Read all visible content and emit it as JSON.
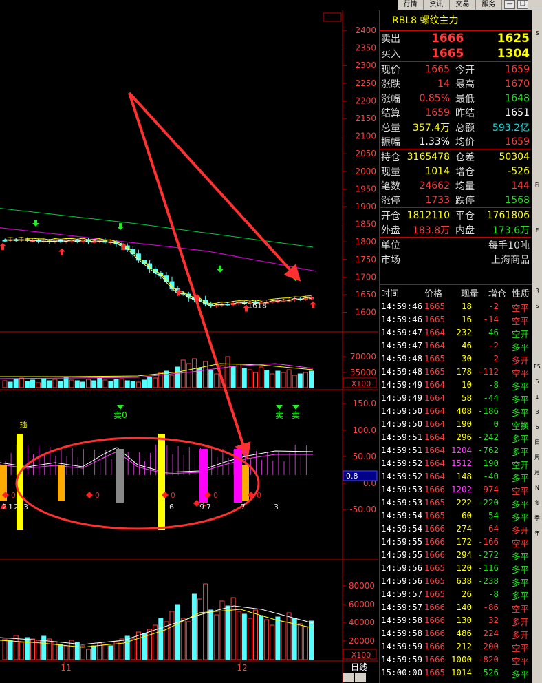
{
  "topbar": {
    "tabs": [
      "行情",
      "资讯",
      "交易",
      "服务"
    ],
    "btn_min": "—",
    "btn_restore": "❐"
  },
  "quote": {
    "title": "RBL8 螺纹主力",
    "sell": {
      "label": "卖出",
      "price": "1666",
      "vol": "1625"
    },
    "buy": {
      "label": "买入",
      "price": "1665",
      "vol": "1304"
    },
    "rows1": [
      {
        "l1": "现价",
        "v1": "1665",
        "c1": "red",
        "l2": "今开",
        "v2": "1659",
        "c2": "red"
      },
      {
        "l1": "涨跌",
        "v1": "14",
        "c1": "red",
        "l2": "最高",
        "v2": "1670",
        "c2": "red"
      },
      {
        "l1": "涨幅",
        "v1": "0.85%",
        "c1": "red",
        "l2": "最低",
        "v2": "1648",
        "c2": "grn"
      },
      {
        "l1": "结算",
        "v1": "1659",
        "c1": "red",
        "l2": "昨结",
        "v2": "1651",
        "c2": "wht"
      },
      {
        "l1": "总量",
        "v1": "357.4万",
        "c1": "yel",
        "l2": "总额",
        "v2": "593.2亿",
        "c2": "cyn"
      },
      {
        "l1": "振幅",
        "v1": "1.33%",
        "c1": "wht",
        "l2": "均价",
        "v2": "1659",
        "c2": "red"
      }
    ],
    "rows2": [
      {
        "l1": "持仓",
        "v1": "3165478",
        "c1": "yel",
        "l2": "仓差",
        "v2": "50304",
        "c2": "yel"
      },
      {
        "l1": "现量",
        "v1": "1014",
        "c1": "yel",
        "l2": "增仓",
        "v2": "-526",
        "c2": "yel"
      },
      {
        "l1": "笔数",
        "v1": "24662",
        "c1": "red",
        "l2": "均量",
        "v2": "144",
        "c2": "red"
      },
      {
        "l1": "涨停",
        "v1": "1733",
        "c1": "red",
        "l2": "跌停",
        "v2": "1568",
        "c2": "grn"
      }
    ],
    "rows3": [
      {
        "l1": "开仓",
        "v1": "1812110",
        "c1": "yel",
        "l2": "平仓",
        "v2": "1761806",
        "c2": "yel"
      },
      {
        "l1": "外盘",
        "v1": "183.8万",
        "c1": "red",
        "l2": "内盘",
        "v2": "173.6万",
        "c2": "grn"
      }
    ],
    "unit": {
      "l": "单位",
      "v": "每手10吨"
    },
    "market": {
      "l": "市场",
      "v": "上海商品"
    }
  },
  "ticks": {
    "headers": [
      "时间",
      "价格",
      "现量",
      "增仓",
      "性质"
    ],
    "rows": [
      [
        "14:59:46",
        "1665",
        "18",
        "-2",
        "空平",
        "red",
        "yel",
        "red",
        "red"
      ],
      [
        "14:59:46",
        "1665",
        "16",
        "-14",
        "空平",
        "red",
        "yel",
        "red",
        "red"
      ],
      [
        "14:59:47",
        "1664",
        "232",
        "46",
        "空开",
        "red",
        "yel",
        "grn",
        "grn"
      ],
      [
        "14:59:47",
        "1664",
        "46",
        "-2",
        "多平",
        "red",
        "yel",
        "red",
        "grn"
      ],
      [
        "14:59:48",
        "1665",
        "30",
        "2",
        "多开",
        "red",
        "yel",
        "red",
        "red"
      ],
      [
        "14:59:48",
        "1665",
        "178",
        "-112",
        "空平",
        "red",
        "yel",
        "red",
        "red"
      ],
      [
        "14:59:49",
        "1664",
        "10",
        "-8",
        "多平",
        "red",
        "yel",
        "grn",
        "grn"
      ],
      [
        "14:59:49",
        "1664",
        "58",
        "-44",
        "多平",
        "red",
        "yel",
        "grn",
        "grn"
      ],
      [
        "14:59:50",
        "1664",
        "408",
        "-186",
        "多平",
        "red",
        "yel",
        "grn",
        "grn"
      ],
      [
        "14:59:50",
        "1664",
        "190",
        "0",
        "空换",
        "red",
        "yel",
        "grn",
        "grn"
      ],
      [
        "14:59:51",
        "1664",
        "296",
        "-242",
        "多平",
        "red",
        "yel",
        "grn",
        "grn"
      ],
      [
        "14:59:51",
        "1664",
        "1204",
        "-762",
        "多平",
        "red",
        "mag",
        "grn",
        "grn"
      ],
      [
        "14:59:52",
        "1664",
        "1512",
        "190",
        "空开",
        "red",
        "mag",
        "grn",
        "grn"
      ],
      [
        "14:59:52",
        "1664",
        "148",
        "-40",
        "多平",
        "red",
        "yel",
        "grn",
        "grn"
      ],
      [
        "14:59:53",
        "1666",
        "1202",
        "-974",
        "空平",
        "red",
        "mag",
        "red",
        "red"
      ],
      [
        "14:59:53",
        "1665",
        "222",
        "-220",
        "多平",
        "red",
        "yel",
        "grn",
        "grn"
      ],
      [
        "14:59:54",
        "1665",
        "60",
        "-54",
        "多平",
        "red",
        "yel",
        "grn",
        "grn"
      ],
      [
        "14:59:54",
        "1666",
        "274",
        "64",
        "多开",
        "red",
        "yel",
        "red",
        "red"
      ],
      [
        "14:59:55",
        "1666",
        "172",
        "-166",
        "空平",
        "red",
        "yel",
        "red",
        "red"
      ],
      [
        "14:59:55",
        "1666",
        "294",
        "-272",
        "多平",
        "red",
        "yel",
        "grn",
        "grn"
      ],
      [
        "14:59:56",
        "1665",
        "120",
        "-116",
        "多平",
        "red",
        "yel",
        "grn",
        "grn"
      ],
      [
        "14:59:56",
        "1665",
        "638",
        "-238",
        "多平",
        "red",
        "yel",
        "grn",
        "grn"
      ],
      [
        "14:59:57",
        "1665",
        "26",
        "-8",
        "多平",
        "red",
        "yel",
        "grn",
        "grn"
      ],
      [
        "14:59:57",
        "1666",
        "140",
        "-86",
        "空平",
        "red",
        "yel",
        "red",
        "red"
      ],
      [
        "14:59:58",
        "1666",
        "130",
        "32",
        "多开",
        "red",
        "yel",
        "red",
        "red"
      ],
      [
        "14:59:58",
        "1666",
        "486",
        "224",
        "多开",
        "red",
        "yel",
        "red",
        "red"
      ],
      [
        "14:59:59",
        "1666",
        "212",
        "-200",
        "空平",
        "red",
        "yel",
        "red",
        "red"
      ],
      [
        "14:59:59",
        "1666",
        "1000",
        "-820",
        "空平",
        "red",
        "yel",
        "red",
        "red"
      ],
      [
        "15:00:00",
        "1665",
        "1014",
        "-526",
        "多平",
        "red",
        "yel",
        "grn",
        "grn"
      ]
    ]
  },
  "axes": {
    "price": [
      "2400",
      "2350",
      "2300",
      "2250",
      "2200",
      "2150",
      "2100",
      "2050",
      "2000",
      "1950",
      "1900",
      "1850",
      "1800",
      "1750",
      "1700",
      "1650",
      "1600"
    ],
    "vol1": [
      "70000",
      "35000"
    ],
    "vol1_unit": "X100",
    "osc": [
      "150.0",
      "100.0",
      "50.00",
      "0.0",
      "-50.00"
    ],
    "osc_value": "0.8",
    "vol2": [
      "80000",
      "60000",
      "40000",
      "20000"
    ],
    "vol2_unit": "X100",
    "dates": [
      "11",
      "12"
    ],
    "period": "日线",
    "low_label": "1618",
    "signals": [
      "卖0",
      "卖",
      "卖"
    ],
    "nums": [
      "2",
      "1",
      "2",
      "3",
      "6",
      "9",
      "7",
      "7",
      "3"
    ],
    "zero_marks": [
      "0",
      "0",
      "0",
      "0",
      "0",
      "0"
    ],
    "top_label": "插"
  },
  "sidebar": [
    "",
    "S",
    "",
    "",
    "",
    "",
    "",
    "",
    "",
    "",
    "",
    "Fi",
    "",
    "",
    "F",
    "",
    "",
    "",
    "R",
    "S",
    "",
    "",
    "",
    "F5",
    "5",
    "1",
    "3",
    "6",
    "日",
    "周",
    "月",
    "N",
    "多",
    "季",
    "年"
  ],
  "colors": {
    "red": "#ff3b3b",
    "cyan": "#55ffff",
    "magenta": "#ff00ff",
    "yellow": "#ffff00",
    "axis": "#c00000"
  }
}
